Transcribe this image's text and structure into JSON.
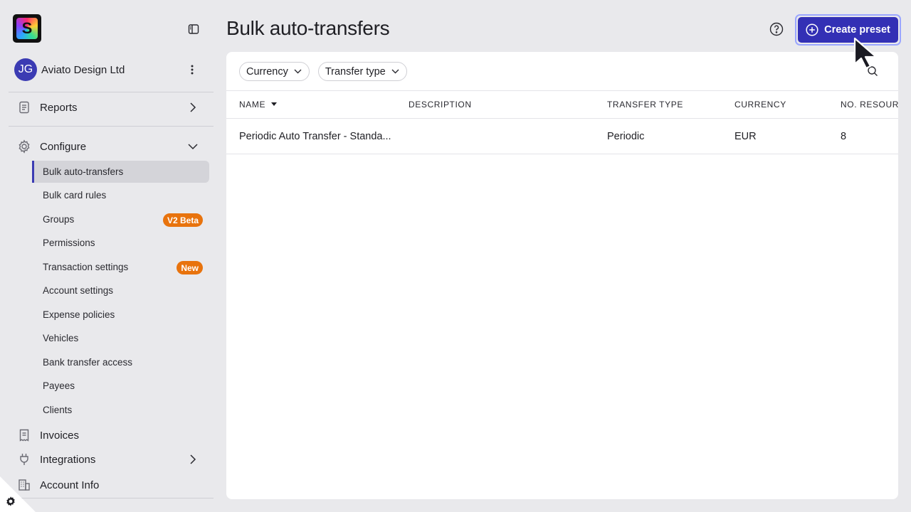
{
  "sidebar": {
    "logo_letter": "S",
    "org": {
      "initials": "JG",
      "name": "Aviato Design Ltd"
    },
    "nav": {
      "reports": "Reports",
      "configure": "Configure",
      "invoices": "Invoices",
      "integrations": "Integrations",
      "account_info": "Account Info"
    },
    "configure_items": [
      {
        "label": "Bulk auto-transfers",
        "active": true
      },
      {
        "label": "Bulk card rules"
      },
      {
        "label": "Groups",
        "badge": "V2 Beta"
      },
      {
        "label": "Permissions"
      },
      {
        "label": "Transaction settings",
        "badge": "New"
      },
      {
        "label": "Account settings"
      },
      {
        "label": "Expense policies"
      },
      {
        "label": "Vehicles"
      },
      {
        "label": "Bank transfer access"
      },
      {
        "label": "Payees"
      },
      {
        "label": "Clients"
      }
    ]
  },
  "header": {
    "title": "Bulk auto-transfers",
    "create_label": "Create preset"
  },
  "filters": {
    "currency": "Currency",
    "transfer_type": "Transfer type"
  },
  "table": {
    "columns": [
      "NAME",
      "DESCRIPTION",
      "TRANSFER TYPE",
      "CURRENCY",
      "NO. RESOURC"
    ],
    "rows": [
      [
        "Periodic Auto Transfer - Standa...",
        "",
        "Periodic",
        "EUR",
        "8"
      ]
    ]
  },
  "colors": {
    "accent": "#3330b5",
    "badge": "#e8730d",
    "background": "#e9e9ec"
  }
}
